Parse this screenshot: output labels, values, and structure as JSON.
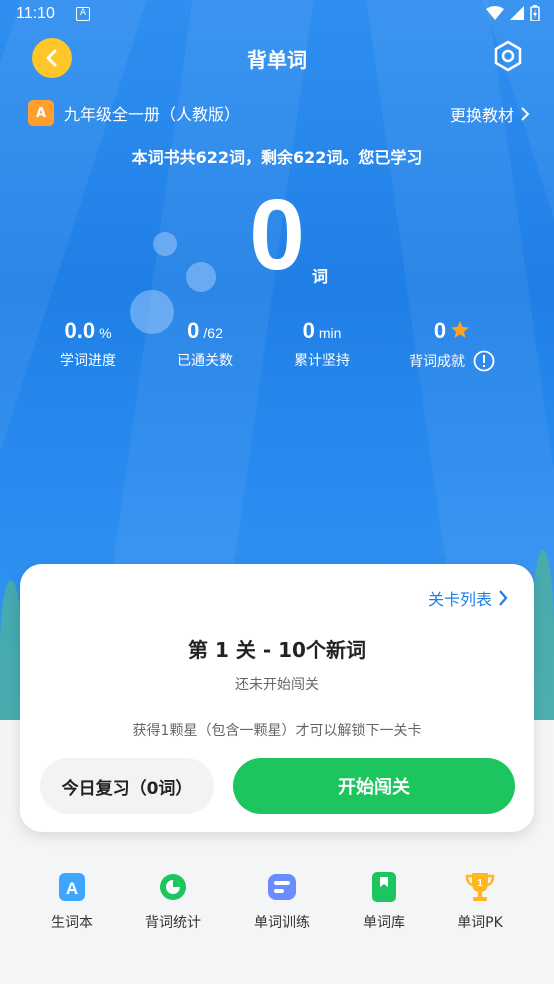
{
  "status_bar": {
    "time": "11:10"
  },
  "header": {
    "title": "背单词"
  },
  "book": {
    "icon_letter": "A",
    "name": "九年级全一册（人教版）",
    "change_label": "更换教材"
  },
  "summary": {
    "text": "本词书共622词，剩余622词。您已学习",
    "learned_count": "0",
    "unit": "词"
  },
  "stats": [
    {
      "value": "0.0",
      "unit": "%",
      "label": "学词进度"
    },
    {
      "value": "0",
      "unit": "/62",
      "label": "已通关数"
    },
    {
      "value": "0",
      "unit": "min",
      "label": "累计坚持"
    },
    {
      "value": "0",
      "unit": "",
      "label": "背词成就"
    }
  ],
  "level_card": {
    "list_label": "关卡列表",
    "title": "第 1 关 - 10个新词",
    "status": "还未开始闯关",
    "hint": "获得1颗星（包含一颗星）才可以解锁下一关卡",
    "review_label": "今日复习（0词）",
    "start_label": "开始闯关"
  },
  "bottom_nav": [
    {
      "label": "生词本",
      "icon": "vocab-book-icon",
      "color": "#3ea6ff"
    },
    {
      "label": "背词统计",
      "icon": "stats-chart-icon",
      "color": "#1dc55f"
    },
    {
      "label": "单词训练",
      "icon": "training-icon",
      "color": "#6b8cff"
    },
    {
      "label": "单词库",
      "icon": "word-library-icon",
      "color": "#1dc55f"
    },
    {
      "label": "单词PK",
      "icon": "trophy-icon",
      "color": "#ffb620"
    }
  ],
  "colors": {
    "primary_blue": "#1f7fe6",
    "accent_green": "#1dc55f",
    "back_yellow": "#ffc629",
    "star_orange": "#ffa21f"
  }
}
